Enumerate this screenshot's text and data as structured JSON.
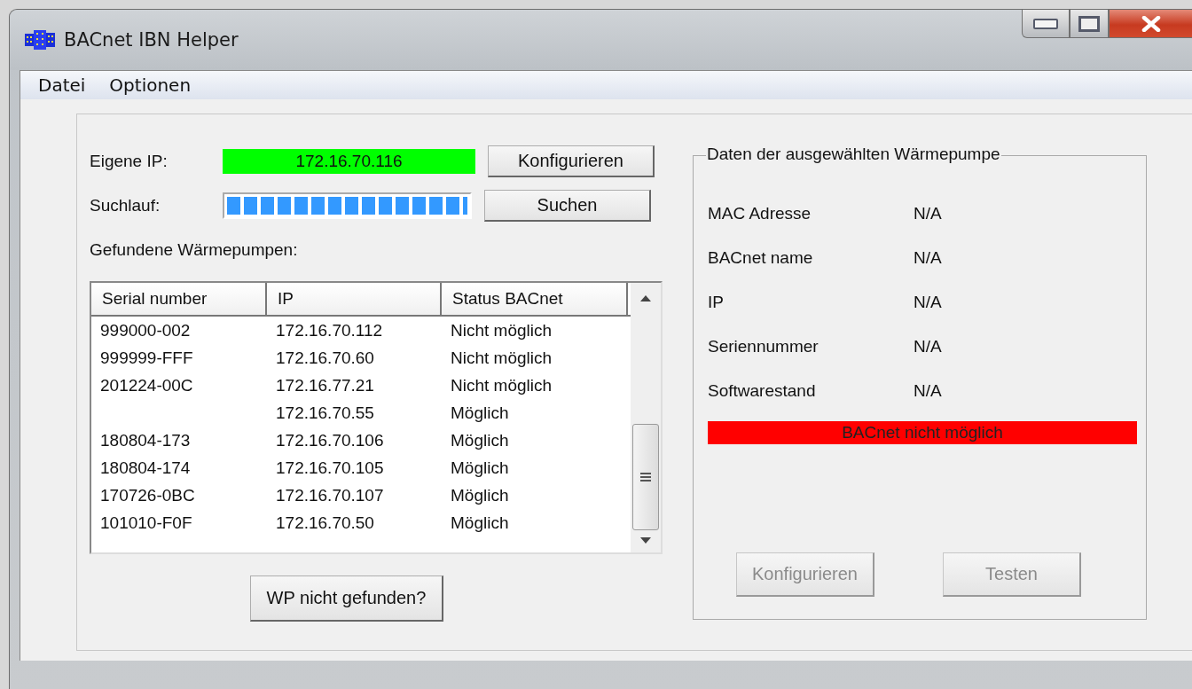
{
  "window": {
    "title": "BACnet IBN Helper"
  },
  "menu": [
    {
      "label": "Datei"
    },
    {
      "label": "Optionen"
    }
  ],
  "own_ip": {
    "label": "Eigene IP:",
    "value": "172.16.70.116",
    "ok": true,
    "button": "Konfigurieren"
  },
  "scan": {
    "label": "Suchlauf:",
    "level": 1,
    "button": "Suchen"
  },
  "found_label": "Gefundene Wärmepumpen:",
  "table": {
    "columns": [
      "Serial number",
      "IP",
      "Status BACnet"
    ],
    "rows": [
      [
        "999000-002",
        "172.16.70.112",
        "Nicht möglich"
      ],
      [
        "999999-FFF",
        "172.16.70.60",
        "Nicht möglich"
      ],
      [
        "201224-00C",
        "172.16.77.21",
        "Nicht möglich"
      ],
      [
        "",
        "172.16.70.55",
        "Möglich"
      ],
      [
        "180804-173",
        "172.16.70.106",
        "Möglich"
      ],
      [
        "180804-174",
        "172.16.70.105",
        "Möglich"
      ],
      [
        "170726-0BC",
        "172.16.70.107",
        "Möglich"
      ],
      [
        "101010-F0F",
        "172.16.70.50",
        "Möglich"
      ]
    ]
  },
  "not_found_button": "WP nicht gefunden?",
  "details": {
    "title": "Daten der ausgewählten Wärmepumpe",
    "fields": [
      {
        "label": "MAC Adresse",
        "value": "N/A"
      },
      {
        "label": "BACnet name",
        "value": "N/A"
      },
      {
        "label": "IP",
        "value": "N/A"
      },
      {
        "label": "Seriennummer",
        "value": "N/A"
      },
      {
        "label": "Softwarestand",
        "value": "N/A"
      }
    ],
    "status": {
      "text": "BACnet nicht möglich",
      "ok": false
    },
    "buttons": [
      {
        "label": "Konfigurieren",
        "disabled": true
      },
      {
        "label": "Testen",
        "disabled": true
      }
    ]
  }
}
